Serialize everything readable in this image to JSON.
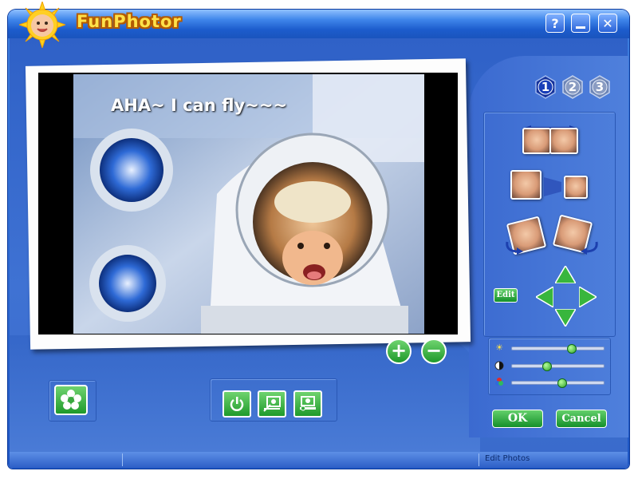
{
  "app": {
    "title": "FunPhotor",
    "help_label": "?",
    "minimize_label": "_",
    "close_label": "✕"
  },
  "photo": {
    "caption": "AHA~ I can fly~~~"
  },
  "zoom": {
    "zoom_in_label": "+",
    "zoom_out_label": "−"
  },
  "steps": [
    {
      "label": "1",
      "active": true
    },
    {
      "label": "2",
      "active": false
    },
    {
      "label": "3",
      "active": false
    }
  ],
  "edit_panel": {
    "edit_label": "Edit",
    "ok_label": "OK",
    "cancel_label": "Cancel"
  },
  "adjustments": {
    "brightness": 0.65,
    "contrast": 0.38,
    "saturation": 0.55
  },
  "status": {
    "text": "Edit Photos"
  },
  "colors": {
    "accent": "#1d56c4",
    "button": "#2fa83a",
    "title": "#ffe14a"
  }
}
